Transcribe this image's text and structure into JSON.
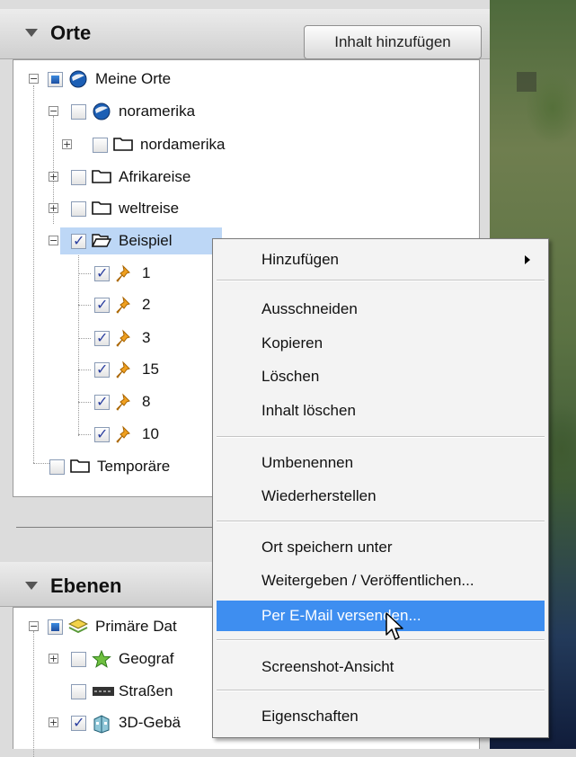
{
  "orte": {
    "title": "Orte",
    "add_button": "Inhalt hinzufügen",
    "items": [
      {
        "label": "Meine Orte",
        "icon": "earth-icon",
        "check": "partial"
      },
      {
        "label": "noramerika",
        "icon": "earth-icon",
        "check": "unchecked"
      },
      {
        "label": "nordamerika",
        "icon": "folder-icon",
        "check": "unchecked"
      },
      {
        "label": "Afrikareise",
        "icon": "folder-icon",
        "check": "unchecked"
      },
      {
        "label": "weltreise",
        "icon": "folder-icon",
        "check": "unchecked"
      },
      {
        "label": "Beispiel",
        "icon": "open-folder-icon",
        "check": "checked"
      },
      {
        "label": "1",
        "icon": "pushpin-icon",
        "check": "checked"
      },
      {
        "label": "2",
        "icon": "pushpin-icon",
        "check": "checked"
      },
      {
        "label": "3",
        "icon": "pushpin-icon",
        "check": "checked"
      },
      {
        "label": "15",
        "icon": "pushpin-icon",
        "check": "checked"
      },
      {
        "label": "8",
        "icon": "pushpin-icon",
        "check": "checked"
      },
      {
        "label": "10",
        "icon": "pushpin-icon",
        "check": "checked"
      },
      {
        "label": "Temporäre",
        "icon": "folder-icon",
        "check": "unchecked"
      }
    ]
  },
  "ebenen": {
    "title": "Ebenen",
    "items": [
      {
        "label": "Primäre Dat",
        "icon": "layers-icon",
        "check": "partial"
      },
      {
        "label": "Geograf",
        "icon": "star-icon",
        "check": "unchecked"
      },
      {
        "label": "Straßen",
        "icon": "road-icon",
        "check": "unchecked"
      },
      {
        "label": "3D-Gebä",
        "icon": "building-icon",
        "check": "checked"
      }
    ]
  },
  "context_menu": {
    "items": [
      {
        "label": "Hinzufügen",
        "has_submenu": true
      },
      {
        "label": "Ausschneiden"
      },
      {
        "label": "Kopieren"
      },
      {
        "label": "Löschen"
      },
      {
        "label": "Inhalt löschen"
      },
      {
        "label": "Umbenennen"
      },
      {
        "label": "Wiederherstellen"
      },
      {
        "label": "Ort speichern unter"
      },
      {
        "label": "Weitergeben / Veröffentlichen..."
      },
      {
        "label": "Per E-Mail versenden...",
        "highlighted": true
      },
      {
        "label": "Screenshot-Ansicht"
      },
      {
        "label": "Eigenschaften"
      }
    ]
  },
  "colors": {
    "selection": "#bdd7f6",
    "menu_highlight": "#3e8ef0",
    "pushpin": "#f0a020"
  }
}
